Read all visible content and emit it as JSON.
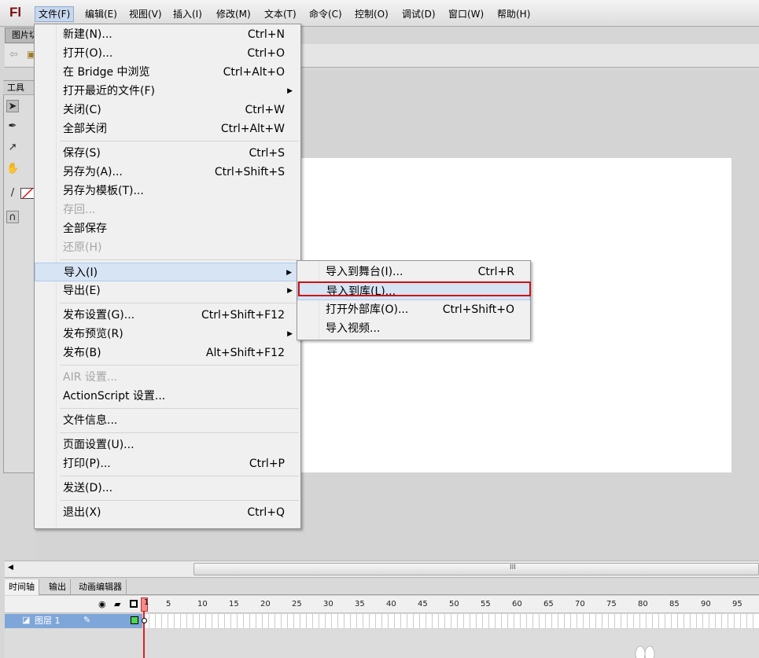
{
  "app": {
    "logo": "Fl"
  },
  "menubar": [
    "文件(F)",
    "编辑(E)",
    "视图(V)",
    "插入(I)",
    "修改(M)",
    "文本(T)",
    "命令(C)",
    "控制(O)",
    "调试(D)",
    "窗口(W)",
    "帮助(H)"
  ],
  "doc_tab": "图片切",
  "tools_title": "工具",
  "file_menu": [
    {
      "label": "新建(N)...",
      "shortcut": "Ctrl+N"
    },
    {
      "label": "打开(O)...",
      "shortcut": "Ctrl+O"
    },
    {
      "label": "在 Bridge 中浏览",
      "shortcut": "Ctrl+Alt+O"
    },
    {
      "label": "打开最近的文件(F)",
      "shortcut": ""
    },
    {
      "label": "关闭(C)",
      "shortcut": "Ctrl+W"
    },
    {
      "label": "全部关闭",
      "shortcut": "Ctrl+Alt+W"
    },
    {
      "label": "保存(S)",
      "shortcut": "Ctrl+S"
    },
    {
      "label": "另存为(A)...",
      "shortcut": "Ctrl+Shift+S"
    },
    {
      "label": "另存为模板(T)...",
      "shortcut": ""
    },
    {
      "label": "存回...",
      "shortcut": ""
    },
    {
      "label": "全部保存",
      "shortcut": ""
    },
    {
      "label": "还原(H)",
      "shortcut": ""
    },
    {
      "label": "导入(I)",
      "shortcut": ""
    },
    {
      "label": "导出(E)",
      "shortcut": ""
    },
    {
      "label": "发布设置(G)...",
      "shortcut": "Ctrl+Shift+F12"
    },
    {
      "label": "发布预览(R)",
      "shortcut": ""
    },
    {
      "label": "发布(B)",
      "shortcut": "Alt+Shift+F12"
    },
    {
      "label": "AIR 设置...",
      "shortcut": ""
    },
    {
      "label": "ActionScript 设置...",
      "shortcut": ""
    },
    {
      "label": "文件信息...",
      "shortcut": ""
    },
    {
      "label": "页面设置(U)...",
      "shortcut": ""
    },
    {
      "label": "打印(P)...",
      "shortcut": "Ctrl+P"
    },
    {
      "label": "发送(D)...",
      "shortcut": ""
    },
    {
      "label": "退出(X)",
      "shortcut": "Ctrl+Q"
    }
  ],
  "import_submenu": [
    {
      "label": "导入到舞台(I)...",
      "shortcut": "Ctrl+R"
    },
    {
      "label": "导入到库(L)...",
      "shortcut": ""
    },
    {
      "label": "打开外部库(O)...",
      "shortcut": "Ctrl+Shift+O"
    },
    {
      "label": "导入视频...",
      "shortcut": ""
    }
  ],
  "timeline": {
    "tabs": [
      "时间轴",
      "输出",
      "动画编辑器"
    ],
    "layer_name": "图层 1",
    "frame_numbers": [
      "1",
      "5",
      "10",
      "15",
      "20",
      "25",
      "30",
      "35",
      "40",
      "45",
      "50",
      "55",
      "60",
      "65",
      "70",
      "75",
      "80",
      "85",
      "90",
      "95"
    ]
  },
  "scrollbar_grip": "III",
  "colors": {
    "highlight_box": "#d01010",
    "layer_selected": "#7fa6d8",
    "playhead": "#e02020"
  }
}
